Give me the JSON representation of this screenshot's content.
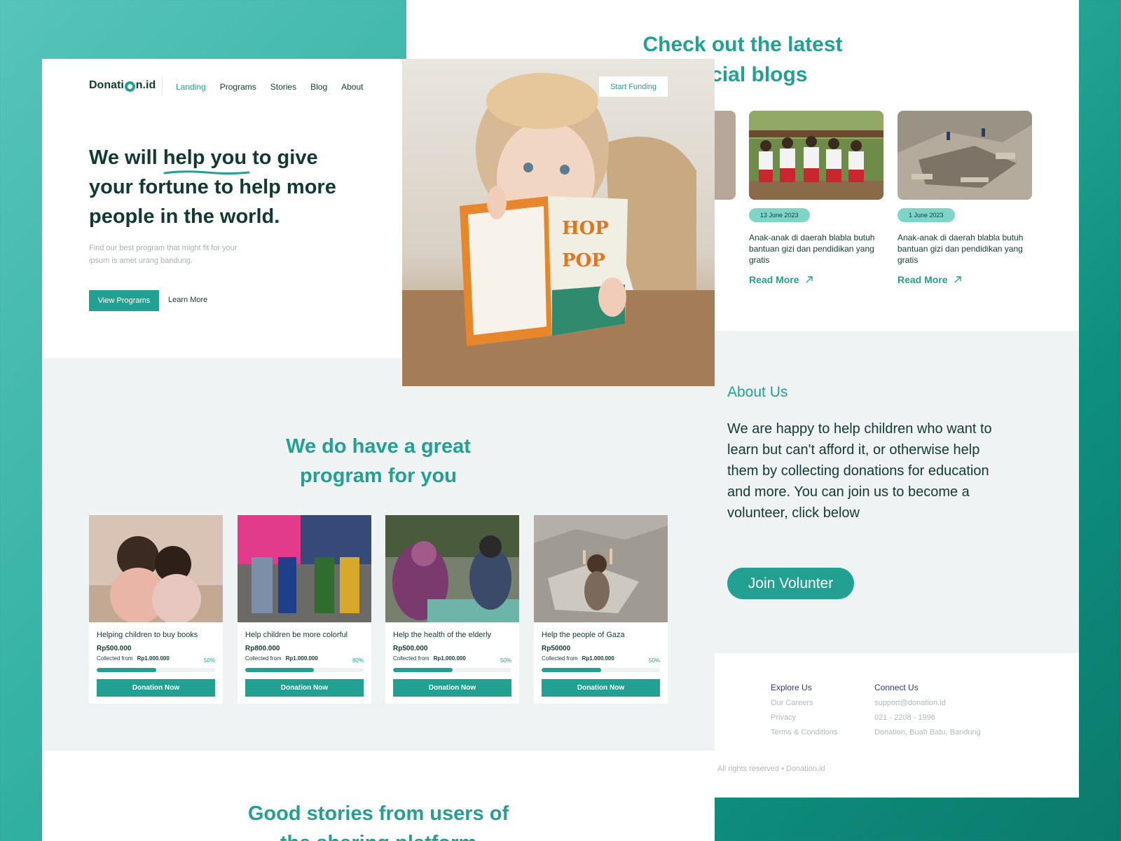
{
  "blogs": {
    "title": "Check out the latest official blogs",
    "cards": [
      {
        "date": "13 June 2023",
        "text": "Anak-anak di daerah blabla butuh bantuan gizi dan pendidikan yang gratis",
        "cta": "Read More"
      },
      {
        "date": "1 June 2023",
        "text": "Anak-anak di daerah blabla butuh bantuan gizi dan pendidikan yang gratis",
        "cta": "Read More"
      }
    ]
  },
  "about": {
    "heading": "About Us",
    "text": "We are happy to help children who want to learn but can't afford it, or otherwise help them by collecting donations for education and more. You can join us to become a volunteer, click below",
    "button": "Join Volunter"
  },
  "footer": {
    "explore": {
      "heading": "Explore Us",
      "links": [
        "Our Careers",
        "Privacy",
        "Terms & Conditions"
      ]
    },
    "connect": {
      "heading": "Connect Us",
      "lines": [
        "support@donation.id",
        "021 - 2208 - 1996",
        "Donation, Buah Batu, Bandung"
      ]
    },
    "rights": "All rights reserved • Donation.id"
  },
  "header": {
    "logo_a": "Donati",
    "logo_b": "n.id",
    "nav": [
      "Landing",
      "Programs",
      "Stories",
      "Blog",
      "About"
    ],
    "start_button": "Start Funding"
  },
  "hero": {
    "title_pre": "We will ",
    "title_em": "help you",
    "title_post": " to give your fortune to help more people in the world.",
    "subtitle": "Find our best program that might fit for your ipsum is amet urang bandung.",
    "primary_button": "View Programs",
    "secondary_link": "Learn More"
  },
  "programs": {
    "title": "We do have a great program for you",
    "cards": [
      {
        "title": "Helping children to buy books",
        "amount": "Rp500.000",
        "collected_label": "Collected from",
        "target": "Rp1.000.000",
        "percent": "50%",
        "progress": 0.5,
        "button": "Donation Now"
      },
      {
        "title": "Help children be more colorful",
        "amount": "Rp800.000",
        "collected_label": "Collected from",
        "target": "Rp1.000.000",
        "percent": "80%",
        "progress": 0.58,
        "button": "Donation Now"
      },
      {
        "title": "Help the health of the elderly",
        "amount": "Rp500.000",
        "collected_label": "Collected from",
        "target": "Rp1.000.000",
        "percent": "50%",
        "progress": 0.5,
        "button": "Donation Now"
      },
      {
        "title": "Help the people of Gaza",
        "amount": "Rp50000",
        "collected_label": "Collected from",
        "target": "Rp1.000.000",
        "percent": "50%",
        "progress": 0.5,
        "button": "Donation Now"
      }
    ]
  },
  "stories": {
    "title": "Good stories from users of the sharing platform"
  },
  "colors": {
    "accent": "#22a092",
    "dark": "#123a33",
    "badge": "#7ed5c7",
    "section_bg": "#eff3f3"
  }
}
